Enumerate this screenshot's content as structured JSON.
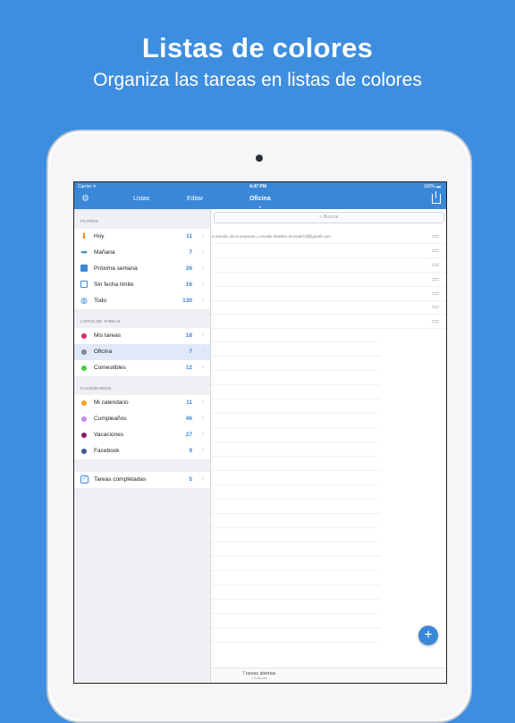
{
  "hero": {
    "title": "Listas de colores",
    "subtitle": "Organiza las tareas en listas de colores"
  },
  "status_bar": {
    "carrier": "Carrier ᯤ",
    "time": "4:47 PM",
    "battery": "100% ▬"
  },
  "nav": {
    "settings_icon": "gear-icon",
    "lists_label": "Listas",
    "edit_label": "Editar",
    "current_list": "Oficina",
    "current_list_caret": "▾",
    "share_icon": "share-icon"
  },
  "sidebar": {
    "filters_header": "FILTROS",
    "filters": [
      {
        "label": "Hoy",
        "count": "11",
        "icon": "arrow-down-icon",
        "color": "#f08a24"
      },
      {
        "label": "Mañana",
        "count": "7",
        "icon": "arrow-right-icon",
        "color": "#3a87d8"
      },
      {
        "label": "Próxima semana",
        "count": "26",
        "icon": "calendar-week-icon",
        "color": "#3a87d8"
      },
      {
        "label": "Sin fecha límite",
        "count": "16",
        "icon": "calendar-icon",
        "color": "#3a87d8"
      },
      {
        "label": "Todo",
        "count": "130",
        "icon": "globe-icon",
        "color": "#3a87d8"
      }
    ],
    "lists_header": "LISTAS DE TAREAS",
    "lists": [
      {
        "label": "Mis tareas",
        "count": "18",
        "color": "#e0246a"
      },
      {
        "label": "Oficina",
        "count": "7",
        "color": "#7b8794",
        "selected": true
      },
      {
        "label": "Comestibles",
        "count": "12",
        "color": "#3fcf3a"
      }
    ],
    "calendars_header": "CALENDARIOS",
    "calendars": [
      {
        "label": "Mi calendario",
        "count": "11",
        "color": "#f5a623"
      },
      {
        "label": "Cumpleaños",
        "count": "46",
        "color": "#c58af0"
      },
      {
        "label": "Vacaciones",
        "count": "27",
        "color": "#8a1a6e"
      },
      {
        "label": "Facebook",
        "count": "9",
        "color": "#3b5998"
      }
    ],
    "completed": {
      "label": "Tareas completadas",
      "count": "5",
      "icon": "checkbox-icon"
    },
    "chevron": "›"
  },
  "main": {
    "search_placeholder": "Buscar",
    "search_icon": "search-icon",
    "first_task": "a reunión de la empresa y enviale detalles al email bill@gmail.com",
    "footer_main": "7 tareas abiertas",
    "footer_sub": "1 finalizada",
    "add_button": "+"
  },
  "colors": {
    "background": "#3e8ee0",
    "accent": "#3a87d8"
  }
}
